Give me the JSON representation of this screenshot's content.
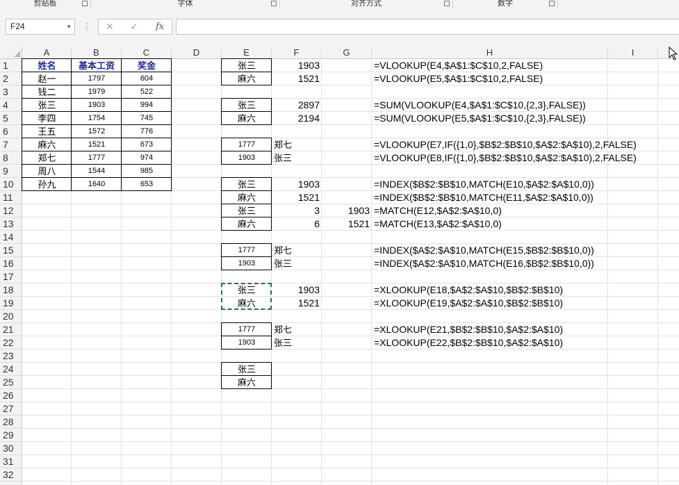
{
  "ribbon": {
    "groups": [
      {
        "label": "剪贴板"
      },
      {
        "label": "字体"
      },
      {
        "label": "对齐方式"
      },
      {
        "label": "数字"
      }
    ]
  },
  "formula_bar": {
    "name_box": "F24",
    "formula": ""
  },
  "columns": [
    "A",
    "B",
    "C",
    "D",
    "E",
    "F",
    "G",
    "H",
    "I"
  ],
  "rows": [
    "1",
    "2",
    "3",
    "4",
    "5",
    "6",
    "7",
    "8",
    "9",
    "10",
    "11",
    "12",
    "13",
    "14",
    "15",
    "16",
    "17",
    "18",
    "19",
    "20",
    "21",
    "22",
    "23",
    "24",
    "25",
    "26",
    "27",
    "28",
    "29",
    "30",
    "31",
    "32"
  ],
  "table": {
    "headers": [
      "姓名",
      "基本工资",
      "奖金"
    ],
    "rows": [
      [
        "赵一",
        "1797",
        "604"
      ],
      [
        "钱二",
        "1979",
        "522"
      ],
      [
        "张三",
        "1903",
        "994"
      ],
      [
        "李四",
        "1754",
        "745"
      ],
      [
        "王五",
        "1572",
        "776"
      ],
      [
        "麻六",
        "1521",
        "673"
      ],
      [
        "郑七",
        "1777",
        "974"
      ],
      [
        "周八",
        "1544",
        "985"
      ],
      [
        "孙九",
        "1640",
        "653"
      ]
    ]
  },
  "lookups": {
    "E1": "张三",
    "F1": "1903",
    "H1": "=VLOOKUP(E4,$A$1:$C$10,2,FALSE)",
    "E2": "麻六",
    "F2": "1521",
    "H2": "=VLOOKUP(E5,$A$1:$C$10,2,FALSE)",
    "E4": "张三",
    "F4": "2897",
    "H4": "=SUM(VLOOKUP(E4,$A$1:$C$10,{2,3},FALSE))",
    "E5": "麻六",
    "F5": "2194",
    "H5": "=SUM(VLOOKUP(E5,$A$1:$C$10,{2,3},FALSE))",
    "E7": "1777",
    "F7": "郑七",
    "H7": "=VLOOKUP(E7,IF({1,0},$B$2:$B$10,$A$2:$A$10),2,FALSE)",
    "E8": "1903",
    "F8": "张三",
    "H8": "=VLOOKUP(E8,IF({1,0},$B$2:$B$10,$A$2:$A$10),2,FALSE)",
    "E10": "张三",
    "F10": "1903",
    "H10": "=INDEX($B$2:$B$10,MATCH(E10,$A$2:$A$10,0))",
    "E11": "麻六",
    "F11": "1521",
    "H11": "=INDEX($B$2:$B$10,MATCH(E11,$A$2:$A$10,0))",
    "E12": "张三",
    "F12": "3",
    "G12": "1903",
    "H12": "=MATCH(E12,$A$2:$A$10,0)",
    "E13": "麻六",
    "F13": "6",
    "G13": "1521",
    "H13": "=MATCH(E13,$A$2:$A$10,0)",
    "E15": "1777",
    "F15": "郑七",
    "H15": "=INDEX($A$2:$A$10,MATCH(E15,$B$2:$B$10,0))",
    "E16": "1903",
    "F16": "张三",
    "H16": "=INDEX($A$2:$A$10,MATCH(E16,$B$2:$B$10,0))",
    "E18": "张三",
    "F18": "1903",
    "H18": "=XLOOKUP(E18,$A$2:$A$10,$B$2:$B$10)",
    "E19": "麻六",
    "F19": "1521",
    "H19": "=XLOOKUP(E19,$A$2:$A$10,$B$2:$B$10)",
    "E21": "1777",
    "F21": "郑七",
    "H21": "=XLOOKUP(E21,$B$2:$B$10,$A$2:$A$10)",
    "E22": "1903",
    "F22": "张三",
    "H22": "=XLOOKUP(E22,$B$2:$B$10,$A$2:$A$10)",
    "E24": "张三",
    "E25": "麻六"
  }
}
